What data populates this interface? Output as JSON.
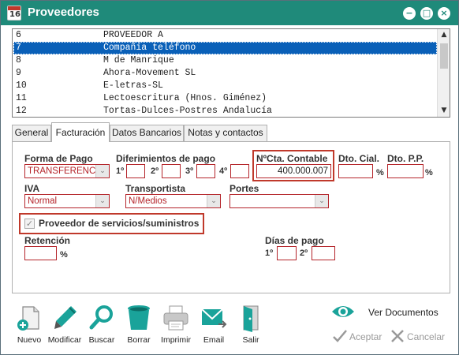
{
  "window": {
    "title": "Proveedores",
    "icon_text": "16"
  },
  "title_buttons": {
    "minimize": "−",
    "restore": "□",
    "close": "×"
  },
  "list": {
    "rows": [
      {
        "code": "6",
        "name": "PROVEEDOR A"
      },
      {
        "code": "7",
        "name": "Compañía teléfono",
        "selected": true
      },
      {
        "code": "8",
        "name": "M de Manrique"
      },
      {
        "code": "9",
        "name": "Ahora-Movement SL"
      },
      {
        "code": "10",
        "name": "E-letras-SL"
      },
      {
        "code": "11",
        "name": "Lectoescritura (Hnos. Giménez)"
      },
      {
        "code": "12",
        "name": "Tortas-Dulces-Postres Andalucía"
      }
    ],
    "scroll_up": "▲",
    "scroll_down": "▼"
  },
  "tabs": [
    {
      "label": "General"
    },
    {
      "label": "Facturación",
      "active": true
    },
    {
      "label": "Datos Bancarios"
    },
    {
      "label": "Notas y contactos"
    }
  ],
  "form": {
    "forma_pago_label": "Forma de Pago",
    "forma_pago_value": "TRANSFERENCIA",
    "diferimientos_label": "Diferimientos de pago",
    "dif1_label": "1º",
    "dif2_label": "2º",
    "dif3_label": "3º",
    "dif4_label": "4º",
    "cta_contable_label": "NºCta. Contable",
    "cta_contable_value": "400.000.007",
    "dto_cial_label": "Dto. Cial.",
    "dto_pp_label": "Dto. P.P.",
    "percent": "%",
    "iva_label": "IVA",
    "iva_value": "Normal",
    "transportista_label": "Transportista",
    "transportista_value": "N/Medios",
    "portes_label": "Portes",
    "portes_value": "",
    "proveedor_servicios_label": "Proveedor de servicios/suministros",
    "proveedor_servicios_checked": true,
    "retencion_label": "Retención",
    "dias_pago_label": "Días de pago",
    "dia1_label": "1º",
    "dia2_label": "2º",
    "check_mark": "✓",
    "dropdown_arrow": "⌄"
  },
  "toolbar": {
    "nuevo": "Nuevo",
    "modificar": "Modificar",
    "buscar": "Buscar",
    "borrar": "Borrar",
    "imprimir": "Imprimir",
    "email": "Email",
    "salir": "Salir",
    "ver_documentos": "Ver Documentos",
    "aceptar": "Aceptar",
    "cancelar": "Cancelar"
  },
  "colors": {
    "titlebar": "#1f8a7a",
    "selection": "#0a60b8",
    "field_border": "#b4242a",
    "icon_teal": "#1aa39a"
  }
}
